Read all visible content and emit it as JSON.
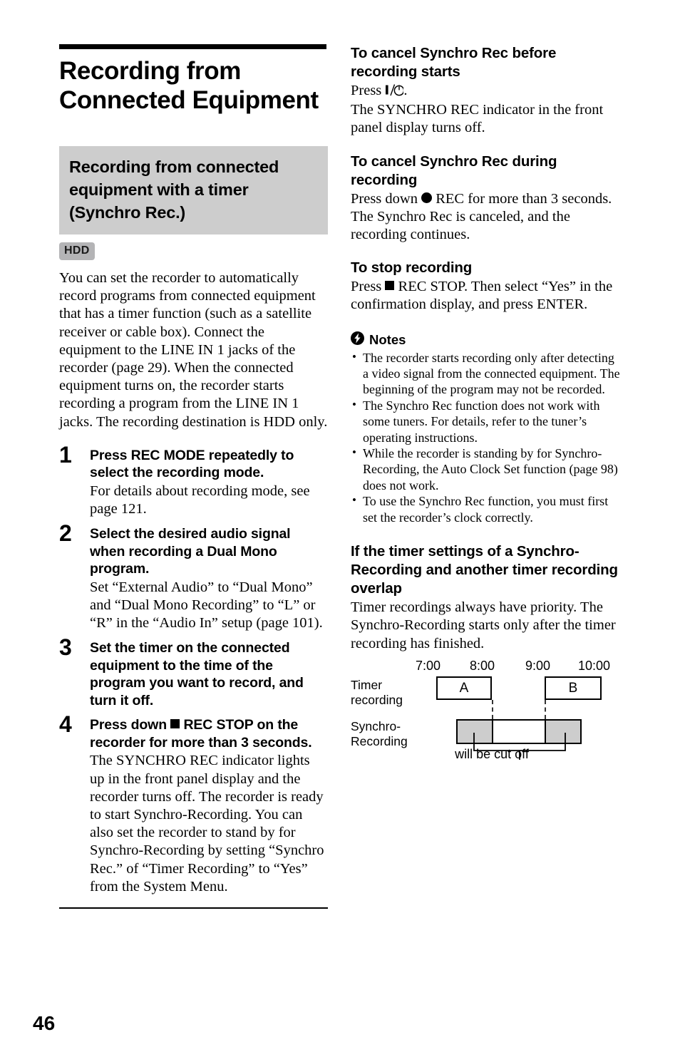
{
  "page": {
    "number": "46"
  },
  "chapter": {
    "title": "Recording from Connected Equipment"
  },
  "section": {
    "heading": "Recording from connected equipment with a timer (Synchro Rec.)",
    "badge": "HDD",
    "intro": "You can set the recorder to automatically record programs from connected equipment that has a timer function (such as a satellite receiver or cable box). Connect the equipment to the LINE IN 1 jacks of the recorder (page 29).\nWhen the connected equipment turns on, the recorder starts recording a program from the LINE IN 1 jacks.\nThe recording destination is HDD only."
  },
  "steps": [
    {
      "number": "1",
      "heading": "Press REC MODE repeatedly to select the recording mode.",
      "detail": "For details about recording mode, see page 121."
    },
    {
      "number": "2",
      "heading": "Select the desired audio signal when recording a Dual Mono program.",
      "detail": "Set “External Audio” to “Dual Mono” and “Dual Mono Recording” to “L” or “R” in the “Audio In” setup (page 101)."
    },
    {
      "number": "3",
      "heading": "Set the timer on the connected equipment to the time of the program you want to record, and turn it off.",
      "detail": ""
    },
    {
      "number": "4",
      "heading_pre": "Press down ",
      "heading_post": " REC STOP on the recorder for more than 3 seconds.",
      "detail": "The SYNCHRO REC indicator lights up in the front panel display and the recorder turns off. The recorder is ready to start Synchro-Recording.\nYou can also set the recorder to stand by for Synchro-Recording by setting “Synchro Rec.” of “Timer Recording” to “Yes” from the System Menu."
    }
  ],
  "right": {
    "cancel_before": {
      "heading": "To cancel Synchro Rec before recording starts",
      "press_pre": "Press ",
      "press_post": ".",
      "body": "The SYNCHRO REC indicator in the front panel display turns off."
    },
    "cancel_during": {
      "heading": "To cancel Synchro Rec during recording",
      "press_pre": "Press down ",
      "press_post": " REC for more than 3 seconds.",
      "body": "The Synchro Rec is canceled, and the recording continues."
    },
    "stop": {
      "heading": "To stop recording",
      "press_pre": "Press ",
      "press_post": " REC STOP. Then select “Yes” in the confirmation display, and press ENTER."
    },
    "notes": {
      "label": "Notes",
      "icon": "flash-circle-icon",
      "items": [
        "The recorder starts recording only after detecting a video signal from the connected equipment. The beginning of the program may not be recorded.",
        "The Synchro Rec function does not work with some tuners. For details, refer to the tuner’s operating instructions.",
        "While the recorder is standing by for Synchro-Recording, the Auto Clock Set function (page 98) does not work.",
        "To use the Synchro Rec function, you must first set the recorder’s clock correctly."
      ]
    },
    "overlap": {
      "heading": "If the timer settings of a Synchro-Recording and another timer recording overlap",
      "body": "Timer recordings always have priority. The Synchro-Recording starts only after the timer recording has finished."
    }
  },
  "diagram": {
    "time_ticks": [
      "7:00",
      "8:00",
      "9:00",
      "10:00"
    ],
    "row1_label": "Timer\nrecording",
    "row2_label": "Synchro-\nRecording",
    "timer_blocks": [
      {
        "label": "A",
        "start": "7:00",
        "end": "8:00"
      },
      {
        "label": "B",
        "start": "9:00",
        "end": "10:00"
      }
    ],
    "synchro_block": {
      "start": "7:20",
      "end": "9:40",
      "cut_start": "8:00",
      "cut_end": "9:00"
    },
    "cutoff_caption": "will be cut off"
  },
  "colors": {
    "gray_panel": "#cdcdcd",
    "badge_gray": "#b4b4b6",
    "rule": "#000000"
  }
}
